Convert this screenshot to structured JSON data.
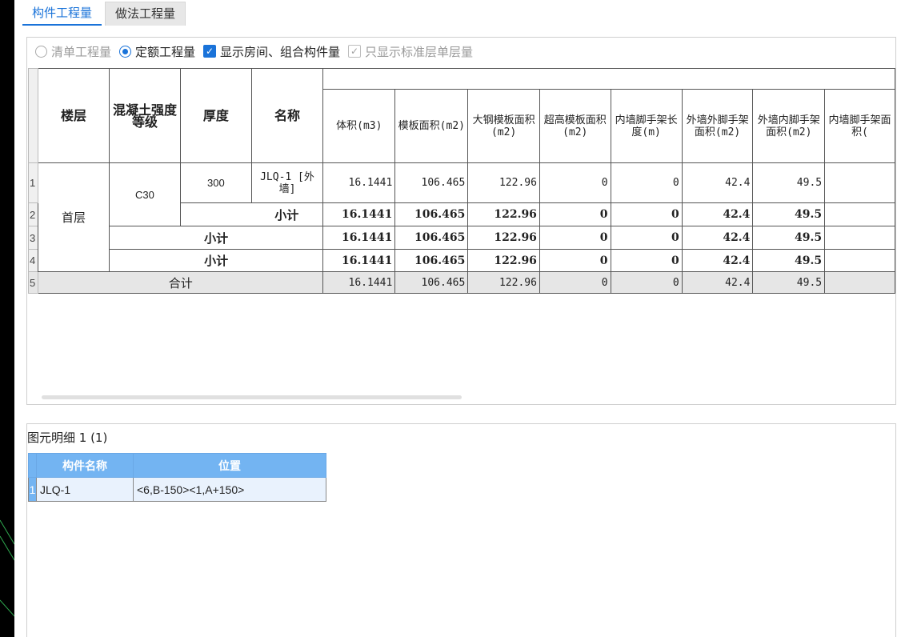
{
  "tabs": [
    {
      "label": "构件工程量",
      "active": true
    },
    {
      "label": "做法工程量",
      "active": false
    }
  ],
  "options": {
    "radio_list": "清单工程量",
    "radio_quota": "定额工程量",
    "check_show_rooms": "显示房间、组合构件量",
    "check_std_floor": "只显示标准层单层量"
  },
  "table": {
    "headers": {
      "floor": "楼层",
      "grade": "混凝土强度等级",
      "thickness": "厚度",
      "name": "名称",
      "volume": "体积(m3)",
      "formwork": "模板面积(m2)",
      "steel_formwork": "大钢模板面积(m2)",
      "super_high": "超高模板面积(m2)",
      "inner_scaffold_len": "内墙脚手架长度(m)",
      "outer_outer": "外墙外脚手架面积(m2)",
      "outer_inner": "外墙内脚手架面积(m2)",
      "inner_scaffold_area": "内墙脚手架面积("
    },
    "row_numbers": [
      "1",
      "2",
      "3",
      "4",
      "5"
    ],
    "floor_value": "首层",
    "grade_value": "C30",
    "thickness_value": "300",
    "name_value": "JLQ-1 [外墙]",
    "subtotal_label": "小计",
    "total_label": "合计",
    "rows": [
      {
        "volume": "16.1441",
        "formwork": "106.465",
        "steel": "122.96",
        "super": "0",
        "inner_len": "0",
        "oo": "42.4",
        "oi": "49.5"
      },
      {
        "volume": "16.1441",
        "formwork": "106.465",
        "steel": "122.96",
        "super": "0",
        "inner_len": "0",
        "oo": "42.4",
        "oi": "49.5"
      },
      {
        "volume": "16.1441",
        "formwork": "106.465",
        "steel": "122.96",
        "super": "0",
        "inner_len": "0",
        "oo": "42.4",
        "oi": "49.5"
      },
      {
        "volume": "16.1441",
        "formwork": "106.465",
        "steel": "122.96",
        "super": "0",
        "inner_len": "0",
        "oo": "42.4",
        "oi": "49.5"
      },
      {
        "volume": "16.1441",
        "formwork": "106.465",
        "steel": "122.96",
        "super": "0",
        "inner_len": "0",
        "oo": "42.4",
        "oi": "49.5"
      }
    ]
  },
  "detail": {
    "title": "图元明细  1 (1)",
    "headers": {
      "component_name": "构件名称",
      "position": "位置"
    },
    "rows": [
      {
        "num": "1",
        "component_name": "JLQ-1",
        "position": "<6,B-150><1,A+150>"
      }
    ]
  },
  "colors": {
    "accent": "#1a73d9",
    "detail_header": "#73b4f2",
    "total_row": "#e6e6e6"
  }
}
